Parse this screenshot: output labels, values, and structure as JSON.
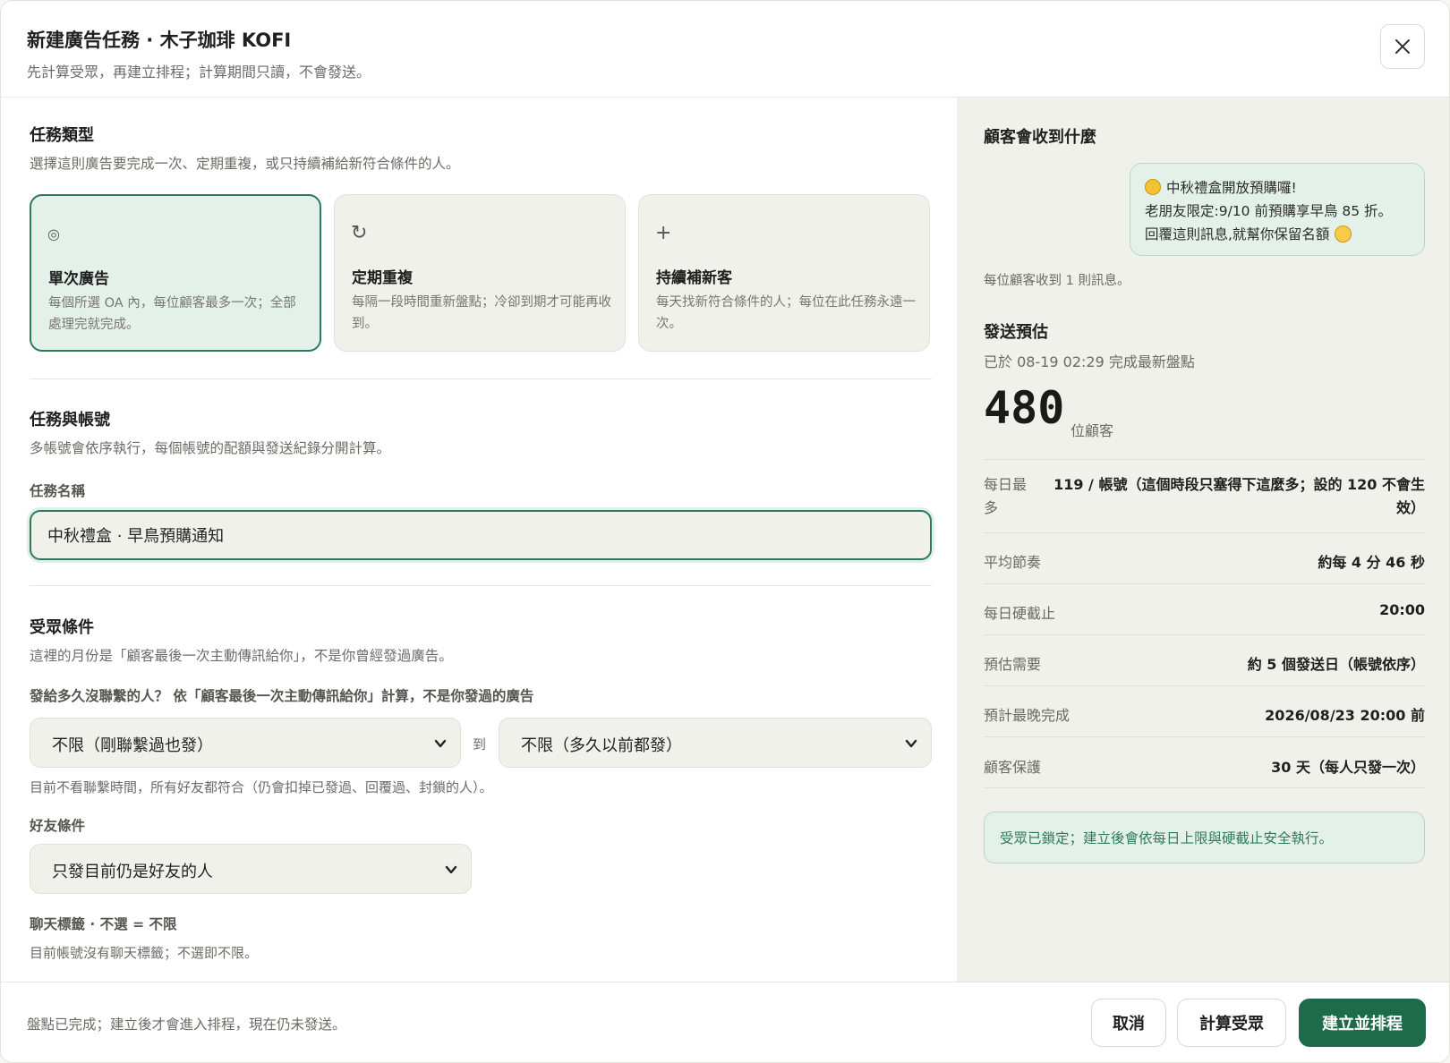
{
  "header": {
    "title": "新建廣告任務 · 木子珈琲 KOFI",
    "subtitle": "先計算受眾，再建立排程；計算期間只讀，不會發送。"
  },
  "task_type": {
    "title": "任務類型",
    "desc": "選擇這則廣告要完成一次、定期重複，或只持續補給新符合條件的人。",
    "cards": [
      {
        "icon": "◎",
        "icon_name": "target-icon",
        "title": "單次廣告",
        "desc": "每個所選 OA 內，每位顧客最多一次；全部處理完就完成。",
        "selected": true
      },
      {
        "icon": "↻",
        "icon_name": "repeat-icon",
        "title": "定期重複",
        "desc": "每隔一段時間重新盤點；冷卻到期才可能再收到。",
        "selected": false
      },
      {
        "icon": "+",
        "icon_name": "plus-icon",
        "title": "持續補新客",
        "desc": "每天找新符合條件的人；每位在此任務永遠一次。",
        "selected": false
      }
    ]
  },
  "task_account": {
    "title": "任務與帳號",
    "desc": "多帳號會依序執行，每個帳號的配額與發送紀錄分開計算。",
    "name_label": "任務名稱",
    "name_value": "中秋禮盒 · 早鳥預購通知"
  },
  "audience": {
    "title": "受眾條件",
    "desc": "這裡的月份是「顧客最後一次主動傳訊給你」，不是你曾經發過廣告。",
    "range_label": "發給多久沒聯繫的人？ 依「顧客最後一次主動傳訊給你」計算，不是你發過的廣告",
    "from_value": "不限（剛聯繫過也發）",
    "to_label": "到",
    "to_value": "不限（多久以前都發）",
    "range_hint": "目前不看聯繫時間，所有好友都符合（仍會扣掉已發過、回覆過、封鎖的人）。",
    "friend_label": "好友條件",
    "friend_value": "只發目前仍是好友的人",
    "tags_label": "聊天標籤 · 不選 = 不限",
    "tags_hint": "目前帳號沒有聊天標籤；不選即不限。"
  },
  "preview": {
    "title": "顧客會收到什麼",
    "message_line1": "中秋禮盒開放預購囉!",
    "message_line2": "老朋友限定:9/10 前預購享早鳥 85 折。",
    "message_line3": "回覆這則訊息,就幫你保留名額",
    "per_customer": "每位顧客收到 1 則訊息。"
  },
  "estimate": {
    "title": "發送預估",
    "updated": "已於 08-19 02:29 完成最新盤點",
    "count": "480",
    "count_unit": "位顧客",
    "rows": [
      {
        "key": "每日最多",
        "value": "119 / 帳號（這個時段只塞得下這麼多；設的 120 不會生效）"
      },
      {
        "key": "平均節奏",
        "value": "約每 4 分 46 秒"
      },
      {
        "key": "每日硬截止",
        "value": "20:00"
      },
      {
        "key": "預估需要",
        "value": "約 5 個發送日（帳號依序）"
      },
      {
        "key": "預計最晚完成",
        "value": "2026/08/23 20:00 前"
      },
      {
        "key": "顧客保護",
        "value": "30 天（每人只發一次）"
      }
    ],
    "notice": "受眾已鎖定；建立後會依每日上限與硬截止安全執行。"
  },
  "footer": {
    "note": "盤點已完成；建立後才會進入排程，現在仍未發送。",
    "cancel": "取消",
    "calculate": "計算受眾",
    "create": "建立並排程"
  },
  "colors": {
    "accent": "#1e6b4c",
    "accent_light": "#e4f1ea",
    "panel": "#f1f1ec"
  }
}
